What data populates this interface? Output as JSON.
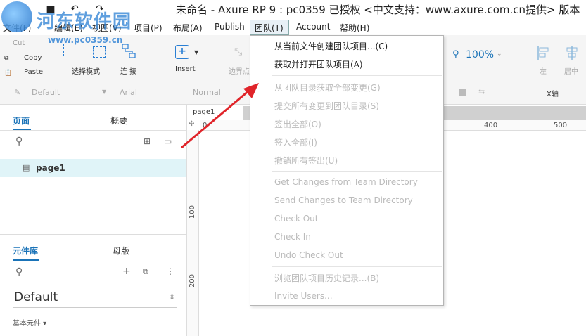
{
  "window": {
    "title": "未命名 - Axure RP 9 : pc0359 已授权 <中文支持：www.axure.com.cn提供> 版本"
  },
  "watermark": {
    "site_name": "河东软件园",
    "url": "www.pc0359.cn"
  },
  "menubar": {
    "items": [
      "文件(F)",
      "编辑(E)",
      "视图(V)",
      "项目(P)",
      "布局(A)",
      "Publish",
      "团队(T)",
      "Account",
      "帮助(H)"
    ]
  },
  "toolbar": {
    "cut": "Cut",
    "copy": "Copy",
    "paste": "Paste",
    "select_mode": "选择模式",
    "connect": "连 接",
    "insert": "Insert",
    "point": "边界点",
    "zoom": "100%",
    "align_left": "左",
    "align_center": "居中"
  },
  "stylebar": {
    "style": "Default",
    "font": "Arial",
    "weight": "Normal",
    "x_label": "X轴"
  },
  "pages_panel": {
    "tab_pages": "页面",
    "tab_outline": "概要",
    "page_item": "page1"
  },
  "library_panel": {
    "tab_library": "元件库",
    "tab_masters": "母版",
    "library_name": "Default",
    "category": "基本元件 ▾"
  },
  "canvas": {
    "tab": "page1",
    "ruler_h": [
      "0",
      "400",
      "500"
    ],
    "ruler_v": [
      "100",
      "200"
    ]
  },
  "team_menu": {
    "items": [
      {
        "label": "从当前文件创建团队项目...(C)",
        "enabled": true
      },
      {
        "label": "获取并打开团队项目(A)",
        "enabled": true
      },
      {
        "label": "从团队目录获取全部变更(G)",
        "enabled": false
      },
      {
        "label": "提交所有变更到团队目录(S)",
        "enabled": false
      },
      {
        "label": "签出全部(O)",
        "enabled": false
      },
      {
        "label": "签入全部(I)",
        "enabled": false
      },
      {
        "label": "撤销所有签出(U)",
        "enabled": false
      },
      {
        "label": "Get Changes from Team Directory",
        "enabled": false
      },
      {
        "label": "Send Changes to Team Directory",
        "enabled": false
      },
      {
        "label": "Check Out",
        "enabled": false
      },
      {
        "label": "Check In",
        "enabled": false
      },
      {
        "label": "Undo Check Out",
        "enabled": false
      },
      {
        "label": "浏览团队项目历史记录...(B)",
        "enabled": false
      },
      {
        "label": "Invite Users...",
        "enabled": false
      }
    ]
  },
  "colors": {
    "accent": "#1a73b8",
    "arrow": "#e0242a"
  }
}
